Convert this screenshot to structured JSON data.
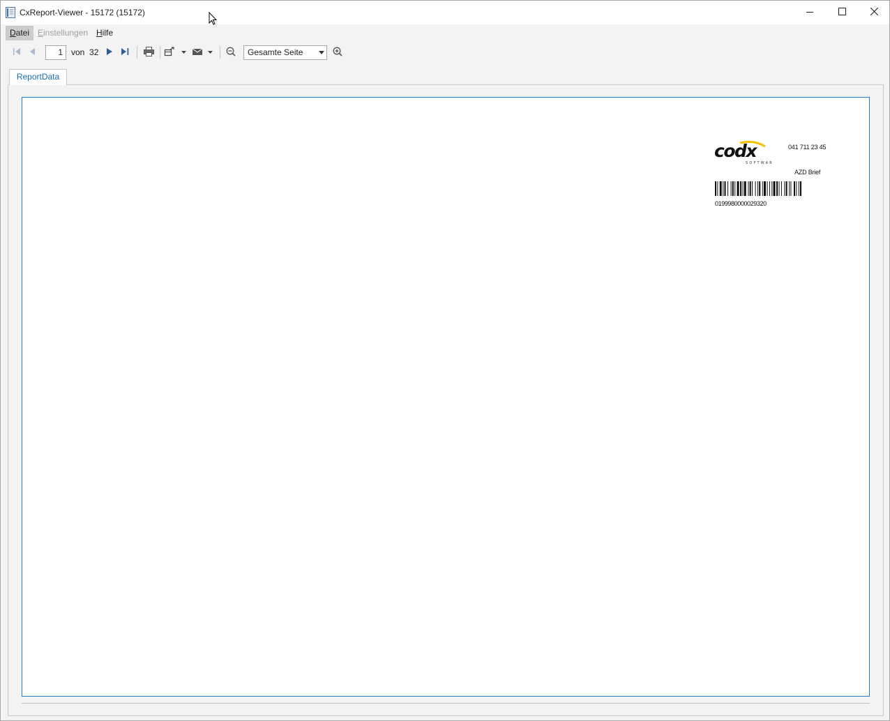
{
  "window": {
    "title": "CxReport-Viewer - 15172 (15172)"
  },
  "menu": {
    "items": [
      {
        "label": "Datei",
        "accel": "D",
        "rest": "atei"
      },
      {
        "label": "Einstellungen",
        "accel": "E",
        "rest": "instellungen"
      },
      {
        "label": "Hilfe",
        "accel": "H",
        "rest": "ilfe"
      }
    ]
  },
  "toolbar": {
    "current_page": "1",
    "of_label": "von",
    "total_pages": "32",
    "zoom_option": "Gesamte Seite"
  },
  "tabs": [
    {
      "label": "ReportData"
    }
  ],
  "report": {
    "logo_text": "codx",
    "logo_subtext": "SOFTWARE",
    "phone": "041 711 23 45",
    "doc_type": "AZD Brief",
    "barcode_number": "0199980000029320"
  },
  "icons": [
    "report-app-icon",
    "minimize-icon",
    "maximize-icon",
    "close-icon",
    "first-page-icon",
    "previous-page-icon",
    "next-page-icon",
    "last-page-icon",
    "print-icon",
    "export-icon",
    "mail-icon",
    "zoom-out-icon",
    "zoom-in-icon",
    "mouse-cursor-icon"
  ],
  "colors": {
    "accent": "#1a6fb0",
    "page_border": "#2b7bc4",
    "logo_swoosh": "#f2c200"
  }
}
